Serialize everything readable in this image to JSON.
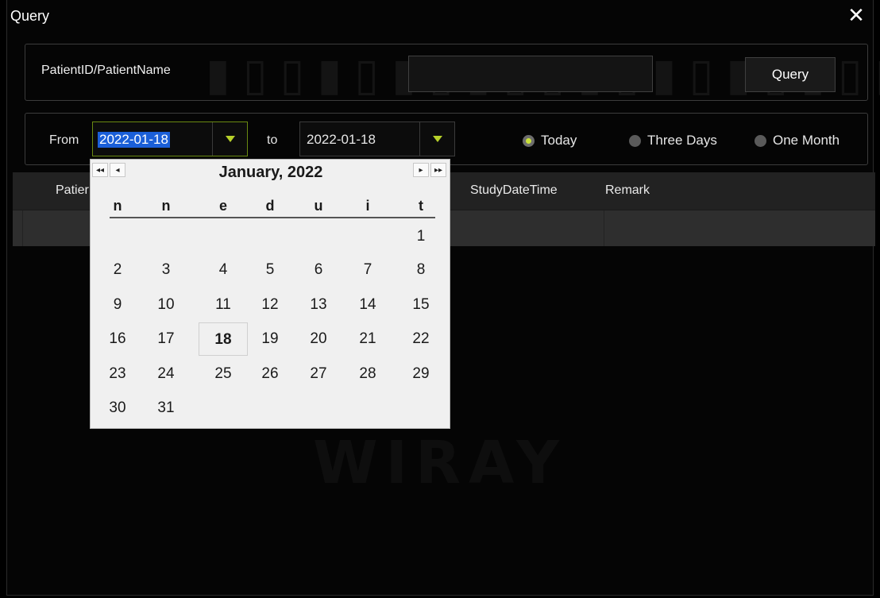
{
  "window": {
    "title": "Query"
  },
  "watermark": {
    "text": "WIRAY"
  },
  "search": {
    "label": "PatientID/PatientName",
    "input_value": "",
    "query_button": "Query"
  },
  "dates": {
    "from_label": "From",
    "from_value": "2022-01-18",
    "to_label": "to",
    "to_value": "2022-01-18",
    "ranges": [
      {
        "label": "Today",
        "selected": true
      },
      {
        "label": "Three Days",
        "selected": false
      },
      {
        "label": "One Month",
        "selected": false
      }
    ]
  },
  "grid": {
    "columns": [
      "Patier",
      "StudyDateTime",
      "Remark"
    ]
  },
  "calendar": {
    "title": "January, 2022",
    "weekdays": [
      "n",
      "n",
      "e",
      "d",
      "u",
      "i",
      "t"
    ],
    "weeks": [
      [
        "",
        "",
        "",
        "",
        "",
        "",
        "1"
      ],
      [
        "2",
        "3",
        "4",
        "5",
        "6",
        "7",
        "8"
      ],
      [
        "9",
        "10",
        "11",
        "12",
        "13",
        "14",
        "15"
      ],
      [
        "16",
        "17",
        "18",
        "19",
        "20",
        "21",
        "22"
      ],
      [
        "23",
        "24",
        "25",
        "26",
        "27",
        "28",
        "29"
      ],
      [
        "30",
        "31",
        "",
        "",
        "",
        "",
        ""
      ]
    ],
    "selected_day": "18",
    "nav": {
      "prev_year": "◂◂",
      "prev_month": "◂",
      "next_month": "▸",
      "next_year": "▸▸"
    }
  },
  "colors": {
    "accent": "#b7d12a",
    "selection": "#1b5fd8",
    "background": "#050505",
    "header_row": "#222222",
    "data_row": "#2e2e2e"
  }
}
